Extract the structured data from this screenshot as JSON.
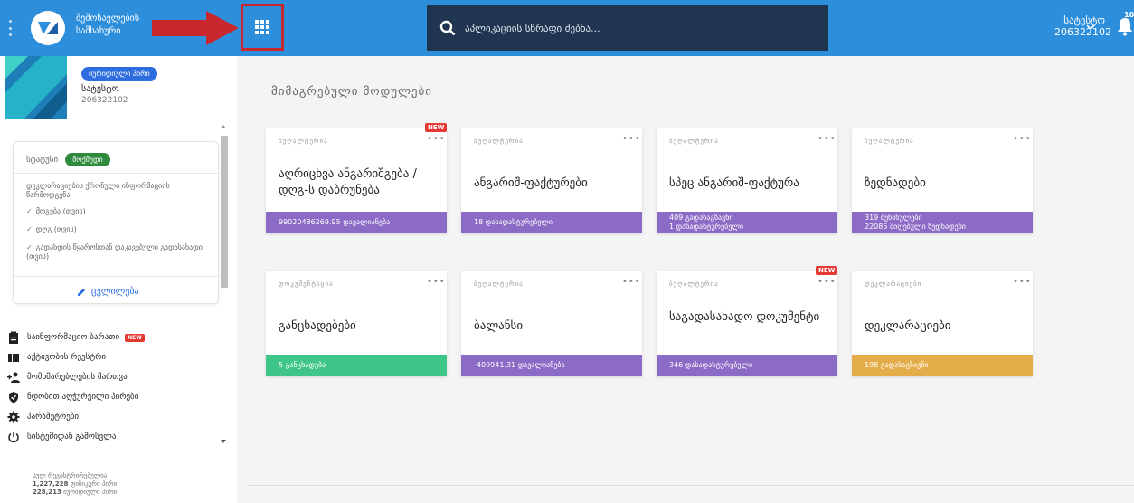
{
  "brand": {
    "line1": "შემოსავლების",
    "line2": "სამსახური"
  },
  "search": {
    "placeholder": "აპლიკაციის სწრაფი ძებნა..."
  },
  "user": {
    "name": "სატესტო",
    "id": "206322102",
    "notifications": "10"
  },
  "profile": {
    "badge": "იურიდიული პირი",
    "name": "სატესტო",
    "id": "206322102"
  },
  "status": {
    "label": "სტატუსი",
    "value": "მოქმედი",
    "declaration_title": "დეკლარაციების ქრონული ინფორმაციის წარმოდგენა",
    "checks": [
      "მოგება (თვის)",
      "დღგ (თვის)",
      "გადახდის წყაროსთან დაკავებული გადასახადი (თვის)"
    ],
    "edit_label": "ცვლილება"
  },
  "menu": [
    {
      "label": "საინფორმაციო ბარათი",
      "new": "NEW"
    },
    {
      "label": "აქტივობის რეესტრი"
    },
    {
      "label": "მომხმარებლების მართვა"
    },
    {
      "label": "ნდობით აღჭურვილი პირები"
    },
    {
      "label": "პარამეტრები"
    },
    {
      "label": "სისტემიდან გამოსვლა"
    }
  ],
  "stats": {
    "title": "სულ რეგისტრირებულია",
    "physical_count": "1,227,228",
    "physical_label": "ფიზიკური პირი",
    "legal_count": "228,213",
    "legal_label": "იურიდიული პირი"
  },
  "main": {
    "title": "მიმაგრებული მოდულები",
    "cards": [
      {
        "category": "ბუღალტერია",
        "title": "აღრიცხვა ანგარიშგება / დღგ-ს დაბრუნება",
        "footer": [
          "99020486269.95 დავალიანება"
        ],
        "new": "NEW"
      },
      {
        "category": "ბუღალტერია",
        "title": "ანგარიშ-ფაქტურები",
        "footer": [
          "18 დასადასტურებელი"
        ]
      },
      {
        "category": "ბუღალტერია",
        "title": "სპეც ანგარიშ-ფაქტურა",
        "footer": [
          "409 გადასაგზავნი",
          "1 დასადასტურებელი"
        ]
      },
      {
        "category": "ბუღალტერია",
        "title": "ზედნადები",
        "footer": [
          "319 შენახულები",
          "22085 მიღებული ზედნადები"
        ]
      },
      {
        "category": "დოკუმენტაცია",
        "title": "განცხადებები",
        "footer": [
          "5 განცხადება"
        ]
      },
      {
        "category": "ბუღალტერია",
        "title": "ბალანსი",
        "footer": [
          "-409941.31 დავალიანება"
        ]
      },
      {
        "category": "ბუღალტერია",
        "title": "საგადასახადო დოკუმენტი",
        "footer": [
          "346 დასადასტურებელი"
        ],
        "new": "NEW"
      },
      {
        "category": "დეკლარაციები",
        "title": "დეკლარაციები",
        "footer": [
          "198 გადასაგზავნი"
        ]
      }
    ]
  },
  "colors": {
    "topbar": "#2d8fdc",
    "search_bg": "#1f3550",
    "purple": "#8b6bc6",
    "green": "#3ec587",
    "amber": "#e5ad4a",
    "highlight": "#c9262d"
  }
}
